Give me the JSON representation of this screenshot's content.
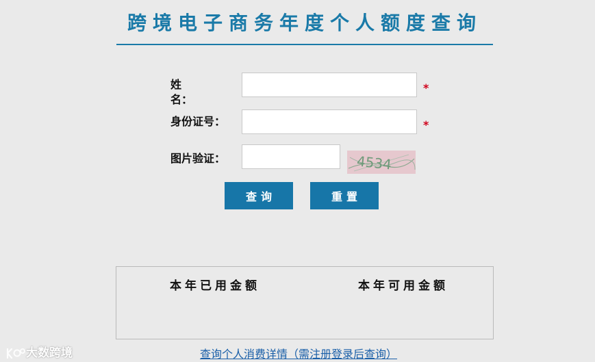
{
  "header": {
    "title": "跨境电子商务年度个人额度查询"
  },
  "form": {
    "name_label_char1": "姓",
    "name_label_char2": "名：",
    "id_label": "身份证号：",
    "captcha_label": "图片验证：",
    "required_mark": "*",
    "name_value": "",
    "id_value": "",
    "captcha_value": "",
    "captcha_image_text": "4534"
  },
  "actions": {
    "query_label": "查询",
    "reset_label": "重置"
  },
  "result": {
    "used_heading": "本年已用金额",
    "available_heading": "本年可用金额"
  },
  "footer": {
    "detail_link": "查询个人消费详情（需注册登录后查询）"
  },
  "watermark": {
    "text": "大数跨境"
  },
  "colors": {
    "accent": "#1a7aa8",
    "button": "#1776a8",
    "required": "#d0021b",
    "background": "#eaeaea"
  }
}
